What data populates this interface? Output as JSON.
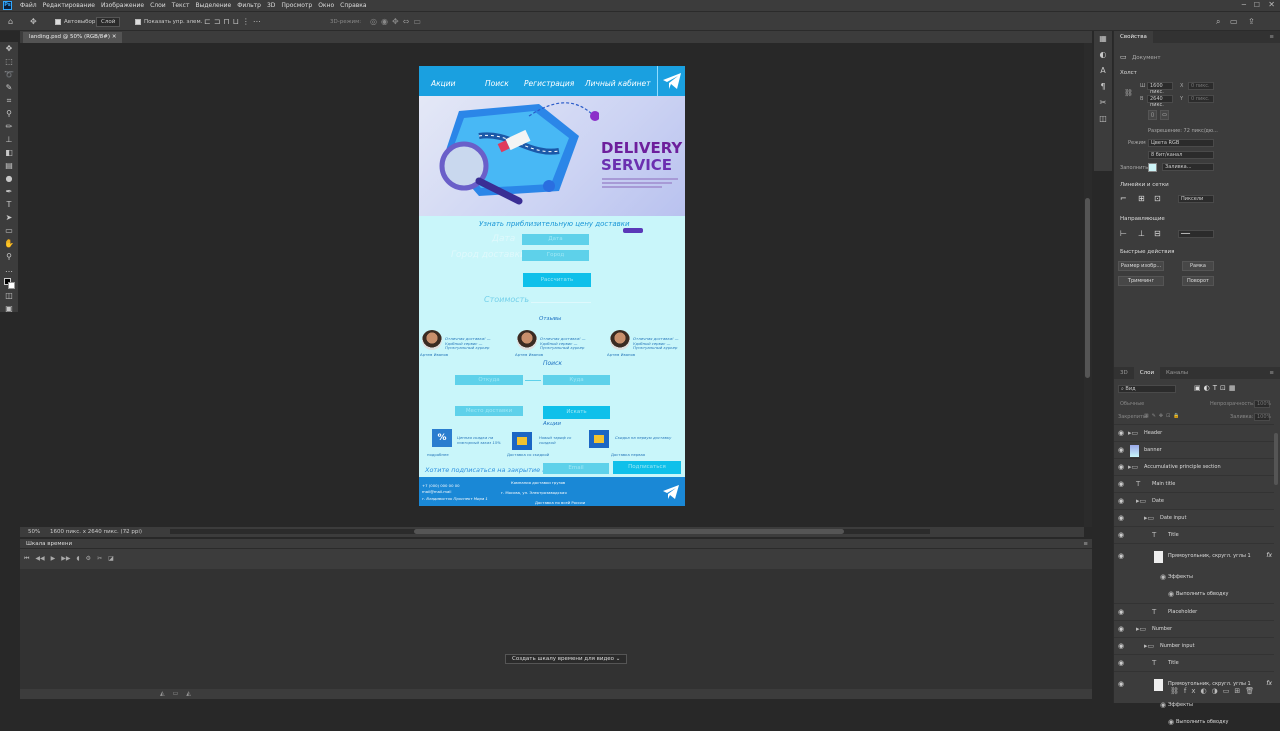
{
  "menubar": {
    "items": [
      "Файл",
      "Редактирование",
      "Изображение",
      "Слои",
      "Текст",
      "Выделение",
      "Фильтр",
      "3D",
      "Просмотр",
      "Окно",
      "Справка"
    ]
  },
  "options": {
    "autoselect_label": "Автовыбор:",
    "autoselect_value": "Слой",
    "show_controls": "Показать упр. элем.",
    "mode_3d": "3D-режим:"
  },
  "tab": {
    "title": "landing.psd @ 50% (RGB/8#)"
  },
  "status": {
    "zoom": "50%",
    "size": "1600 пикс. x 2640 пикс. (72 ppi)"
  },
  "timeline": {
    "title": "Шкала времени",
    "create_button": "Создать шкалу времени для видео"
  },
  "properties": {
    "tabs": [
      "Свойства"
    ],
    "doc_label": "Документ",
    "canvas_title": "Холст",
    "w_label": "Ш",
    "w_value": "1600 пикс.",
    "x_label": "X",
    "x_value": "0 пикс.",
    "h_label": "В",
    "h_value": "2640 пикс.",
    "y_label": "Y",
    "y_value": "0 пикс.",
    "resolution": "Разрешение: 72 пикс/дю...",
    "mode_label": "Режим",
    "mode_value": "Цвета RGB",
    "depth_value": "8 бит/канал",
    "fill_label": "Заполнить",
    "fill_value": "Заливка...",
    "rulers_title": "Линейки и сетки",
    "rulers_unit": "Пиксели",
    "guides_title": "Направляющие",
    "quick_title": "Быстрые действия",
    "quick_actions": [
      "Размер изобр...",
      "Рамка",
      "Тримминг",
      "Поворот"
    ]
  },
  "layers": {
    "tabs": [
      "3D",
      "Слои",
      "Каналы"
    ],
    "filter": "Вид",
    "normal": "Обычные",
    "opacity_label": "Непрозрачность:",
    "opacity_value": "100%",
    "lock_label": "Закрепить:",
    "fill_label": "Заливка:",
    "fill_value": "100%",
    "rows": [
      {
        "name": "Header",
        "kind": "folder",
        "indent": 0
      },
      {
        "name": "banner",
        "kind": "image",
        "indent": 0
      },
      {
        "name": "Accumulative principle section",
        "kind": "folder",
        "indent": 0
      },
      {
        "name": "Main title",
        "kind": "text",
        "indent": 1
      },
      {
        "name": "Date",
        "kind": "folder",
        "indent": 1
      },
      {
        "name": "Date input",
        "kind": "folder",
        "indent": 2
      },
      {
        "name": "Title",
        "kind": "text",
        "indent": 3
      },
      {
        "name": "Прямоугольник, скругл. углы 1",
        "kind": "shape",
        "indent": 3,
        "fx": "fx"
      },
      {
        "name": "Эффекты",
        "kind": "effect",
        "indent": 4
      },
      {
        "name": "Выполнить обводку",
        "kind": "effect",
        "indent": 5
      },
      {
        "name": "Placeholder",
        "kind": "text",
        "indent": 3
      },
      {
        "name": "Number",
        "kind": "folder",
        "indent": 1
      },
      {
        "name": "Number input",
        "kind": "folder",
        "indent": 2
      },
      {
        "name": "Title",
        "kind": "text",
        "indent": 3
      },
      {
        "name": "Прямоугольник, скругл. углы 1",
        "kind": "shape",
        "indent": 3,
        "fx": "fx"
      },
      {
        "name": "Эффекты",
        "kind": "effect",
        "indent": 4
      },
      {
        "name": "Выполнить обводку",
        "kind": "effect",
        "indent": 5
      }
    ]
  },
  "artboard": {
    "nav": [
      "Акции",
      "Поиск",
      "Регистрация",
      "Личный кабинет"
    ],
    "hero_title_1": "DELIVERY",
    "hero_title_2": "SERVICE",
    "calc_title": "Узнать приблизительную цену доставки",
    "date_label": "Дата",
    "date_placeholder": "Дата",
    "city_label": "Город доставки",
    "city_placeholder": "Город",
    "calc_button": "Рассчитать",
    "cost_label": "Стоимость",
    "reviews_title": "Отзывы",
    "reviews": [
      {
        "text": "Отличная доставка! — Удобный сервис — Пунктуальный курьер",
        "name": "Артем Иванов"
      },
      {
        "text": "Отличная доставка! — Удобный сервис — Пунктуальный курьер",
        "name": "Артем Иванов"
      },
      {
        "text": "Отличная доставка! — Удобный сервис — Пунктуальный курьер",
        "name": "Артем Иванов"
      }
    ],
    "search_title": "Поиск",
    "search_from": "Откуда",
    "search_to": "Куда",
    "search_place": "Место доставки",
    "search_button": "Искать",
    "sales_title": "Акции",
    "sales": [
      {
        "icon": "%",
        "text": "Ценная скидка на повторный заказ 15%",
        "caption": "подробнее"
      },
      {
        "icon": "box",
        "text": "Новый тариф со скидкой",
        "caption": "Доставка со скидкой"
      },
      {
        "icon": "box",
        "text": "Скидка на первую доставку",
        "caption": "Доставка первая"
      }
    ],
    "subscribe_text": "Хотите подписаться на закрытие акции?",
    "subscribe_email": "Email",
    "subscribe_button": "Подписаться",
    "footer_phone": "+7 (000) 000 00 00",
    "footer_mail": "mail@mail.mail",
    "footer_address": "г. Владивосток Проспект Мира 1",
    "footer_line1": "Компания доставки грузов",
    "footer_line2": "г. Москва, ул. Электрозаводская",
    "footer_line3": "Доставка по всей России"
  }
}
